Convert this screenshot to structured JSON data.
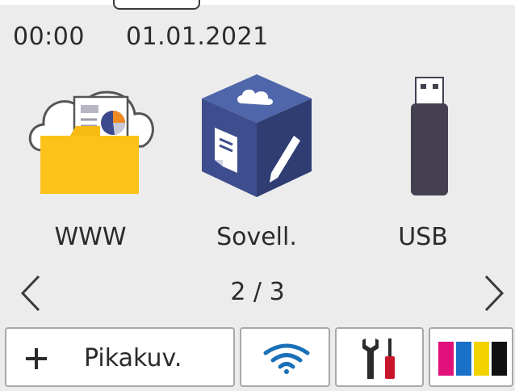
{
  "status": {
    "time": "00:00",
    "date": "01.01.2021"
  },
  "apps": [
    {
      "label": "WWW",
      "icon": "web-cloud-folder-icon"
    },
    {
      "label": "Sovell.",
      "icon": "apps-cube-icon"
    },
    {
      "label": "USB",
      "icon": "usb-drive-icon"
    }
  ],
  "pager": {
    "indicator": "2 / 3"
  },
  "bottom_bar": {
    "shortcut_label": "Pikakuv.",
    "shortcut_icon": "plus-icon",
    "wifi_icon": "wifi-icon",
    "settings_icon": "tools-icon",
    "ink_icon": "ink-cartridges-icon",
    "ink_colors": [
      "#e0117a",
      "#1b70c7",
      "#f2d300",
      "#111111"
    ]
  },
  "colors": {
    "background": "#ececec",
    "folder": "#f8bb14",
    "cube": "#3b4a8c",
    "usb": "#444050",
    "wifi": "#1a70b8",
    "screwdriver": "#c8152a"
  }
}
